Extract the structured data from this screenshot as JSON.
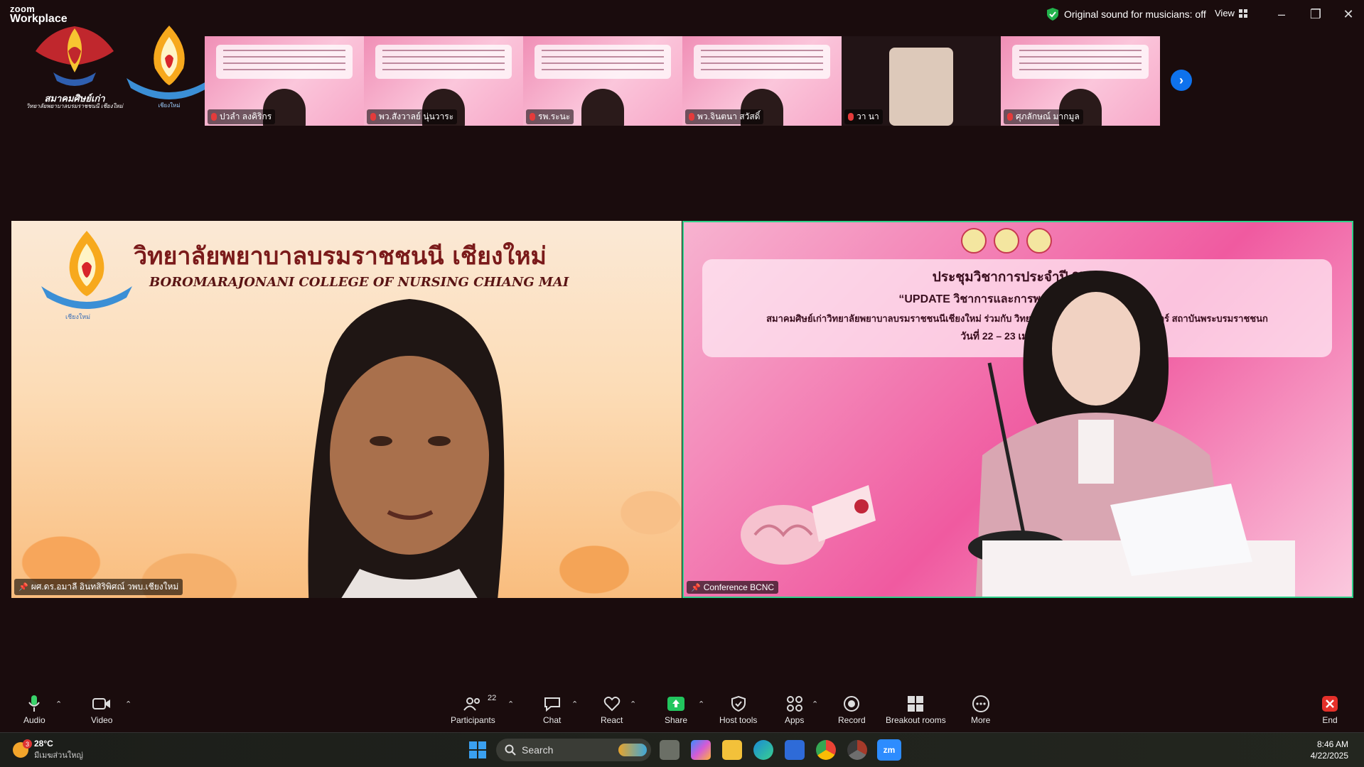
{
  "titlebar": {
    "brand_top": "zoom",
    "brand_bottom": "Workplace",
    "original_sound": "Original sound for musicians: off",
    "view_label": "View"
  },
  "logos": {
    "association_text": "สมาคมศิษย์เก่า",
    "association_sub": "วิทยาลัยพยาบาลบรมราชชนนี เชียงใหม่",
    "college_sub": "เชียงใหม่"
  },
  "thumbnails": [
    {
      "name": "ปวลำ ลงคิริกร",
      "style": "slide"
    },
    {
      "name": "พว.สังวาลย์ นุ่นวาระ",
      "style": "slide"
    },
    {
      "name": "รพ.ระนะ",
      "style": "slide"
    },
    {
      "name": "พว.จินตนา สวัสดิ์",
      "style": "slide"
    },
    {
      "name": "วา นา",
      "style": "dark"
    },
    {
      "name": "ศุภลักษณ์ มากมูล",
      "style": "slide"
    }
  ],
  "main_left": {
    "college_th": "วิทยาลัยพยาบาลบรมราชชนนี  เชียงใหม่",
    "college_en": "BOROMARAJONANI COLLEGE OF NURSING CHIANG MAI",
    "logo_caption": "เชียงใหม่",
    "participant_name": "ผศ.ดร.อมาลี อินทสิริพิศณ์ วพบ.เชียงใหม่"
  },
  "main_right": {
    "line1": "ประชุมวิชาการประจำปี 2568",
    "line2": "“UPDATE วิชาการและการพยา                    ลอดเลือดสมอง”",
    "line3": "สมาคมศิษย์เก่าวิทยาลัยพยาบาลบรมราชชนนีเชียงใหม่ ร่วมกับ วิทยาลัย                  เชียงใหม่ คณะพยาบาลศาสตร์ สถาบันพระบรมราชชนก",
    "line4": "วันที่  22 – 23 เมษา                    อนไลน์",
    "participant_name": "Conference BCNC"
  },
  "toolbar": {
    "audio": "Audio",
    "video": "Video",
    "participants": "Participants",
    "participants_count": "22",
    "chat": "Chat",
    "react": "React",
    "share": "Share",
    "host_tools": "Host tools",
    "apps": "Apps",
    "record": "Record",
    "breakout": "Breakout rooms",
    "more": "More",
    "end": "End"
  },
  "taskbar": {
    "temp": "28°C",
    "location": "มีเมฆส่วนใหญ่",
    "weather_badge": "3",
    "search": "Search",
    "time": "8:46 AM",
    "date": "4/22/2025"
  },
  "colors": {
    "accent_green": "#2fd18a",
    "zoom_blue": "#0e72ed",
    "end_red": "#e5302a"
  }
}
